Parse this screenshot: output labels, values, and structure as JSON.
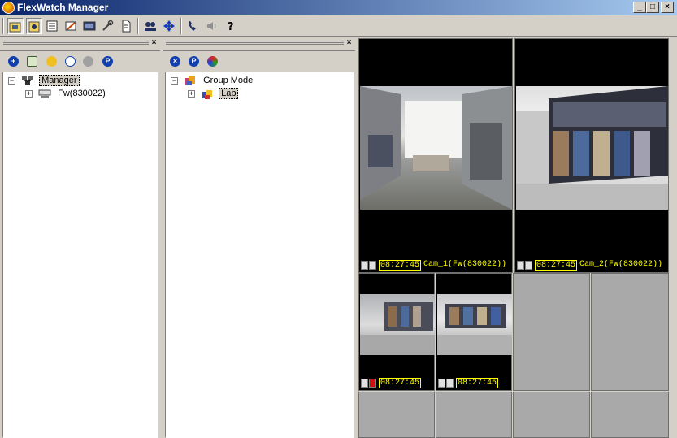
{
  "window": {
    "title": "FlexWatch Manager",
    "minimize": "_",
    "maximize": "□",
    "close": "×"
  },
  "toolbar": {
    "icons": [
      "site-manager-icon",
      "group-mode-icon",
      "list-view-icon",
      "edit-icon",
      "screen-icon",
      "tools-icon",
      "document-icon",
      "user-group-icon",
      "ptz-move-icon",
      "phone-icon",
      "speaker-icon",
      "help-icon"
    ]
  },
  "left_pane": {
    "close": "×",
    "tree": {
      "root_label": "Manager",
      "root_expander": "−",
      "children": [
        {
          "label": "Fw(830022)",
          "expander": "+"
        }
      ]
    }
  },
  "mid_pane": {
    "close": "×",
    "tree": {
      "root_label": "Group Mode",
      "root_expander": "−",
      "children": [
        {
          "label": "Lab",
          "expander": "+"
        }
      ]
    }
  },
  "video": {
    "cells": [
      {
        "time": "08:27:45",
        "name": "Cam_1(Fw(830022))",
        "alarm": false
      },
      {
        "time": "08:27:45",
        "name": "Cam_2(Fw(830022))",
        "alarm": false
      },
      {
        "time": "08:27:45",
        "name": "",
        "alarm": true
      },
      {
        "time": "08:27:45",
        "name": "",
        "alarm": false
      }
    ],
    "accent": "#ffff00"
  }
}
